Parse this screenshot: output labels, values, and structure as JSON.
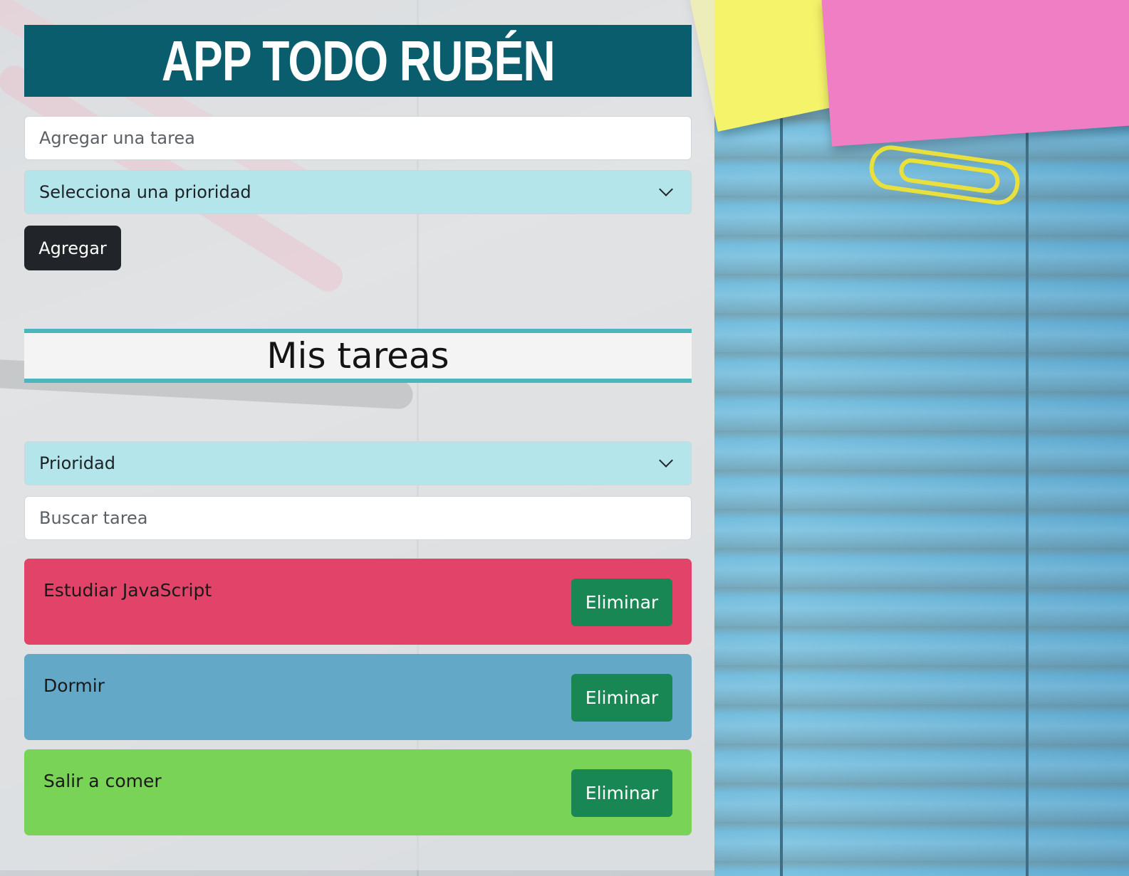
{
  "app": {
    "title": "APP TODO RUBÉN"
  },
  "form": {
    "task_placeholder": "Agregar una tarea",
    "priority_select": "Selecciona una prioridad",
    "add_button": "Agregar"
  },
  "list": {
    "heading": "Mis tareas",
    "filter_select": "Prioridad",
    "search_placeholder": "Buscar tarea",
    "tasks": [
      {
        "name": "Estudiar JavaScript",
        "color": "#e24369",
        "delete_label": "Eliminar"
      },
      {
        "name": "Dormir",
        "color": "#63a8c7",
        "delete_label": "Eliminar"
      },
      {
        "name": "Salir a comer",
        "color": "#79d356",
        "delete_label": "Eliminar"
      }
    ]
  },
  "colors": {
    "header_bg": "#0a5d6c",
    "select_bg": "#b3e5ea",
    "add_button_bg": "#212529",
    "delete_button_bg": "#198754",
    "heading_border": "#4bb6bd"
  }
}
